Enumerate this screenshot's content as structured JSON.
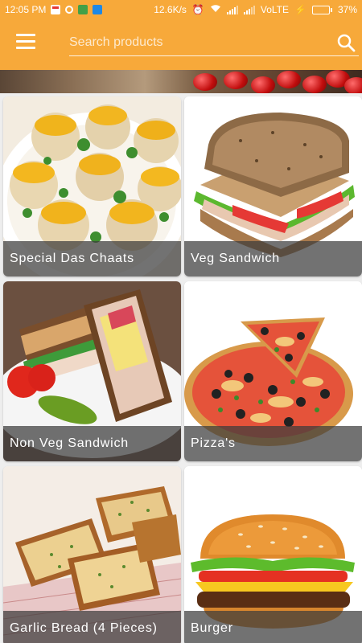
{
  "status_bar": {
    "time": "12:05 PM",
    "speed": "12.6K/s",
    "network": "VoLTE",
    "battery": "37%",
    "battery_level": 0.37,
    "icons": [
      "gmail-icon",
      "opera-icon",
      "android-icon",
      "cloud-icon",
      "alarm-icon",
      "wifi-icon",
      "signal-icon",
      "charging-icon",
      "battery-icon"
    ]
  },
  "app_bar": {
    "menu_icon": "hamburger-menu-icon",
    "search_placeholder": "Search products",
    "search_value": "",
    "search_icon": "search-icon",
    "background_color": "#f7a93a"
  },
  "products": [
    {
      "name": "Special Das Chaats"
    },
    {
      "name": "Veg Sandwich"
    },
    {
      "name": "Non Veg Sandwich"
    },
    {
      "name": "Pizza's"
    },
    {
      "name": "Garlic Bread (4 Pieces)"
    },
    {
      "name": "Burger"
    }
  ]
}
